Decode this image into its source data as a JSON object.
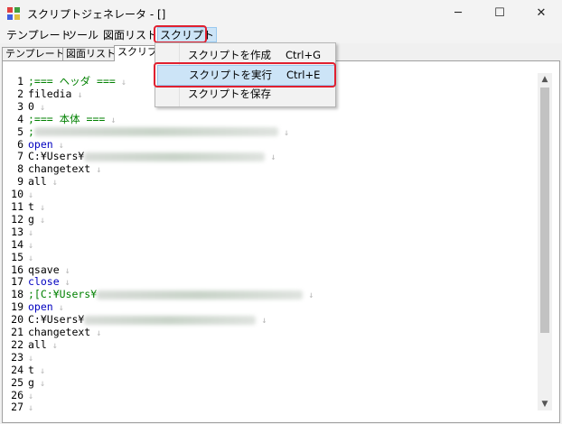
{
  "window": {
    "title": "スクリプトジェネレータ - []",
    "controls": {
      "minimize": "─",
      "maximize": "☐",
      "close": "✕"
    }
  },
  "menubar": {
    "items": [
      "テンプレート",
      "ツール",
      "図面リスト",
      "スクリプト"
    ]
  },
  "tabs": [
    "テンプレート",
    "図面リスト",
    "スクリプト"
  ],
  "dropdown": {
    "items": [
      {
        "label": "スクリプトを作成",
        "shortcut": "Ctrl+G"
      },
      {
        "label": "スクリプトを実行",
        "shortcut": "Ctrl+E"
      },
      {
        "label": "スクリプトを保存",
        "shortcut": ""
      }
    ]
  },
  "editor": {
    "lines": [
      {
        "n": "1",
        "text": ";=== ヘッダ ==="
      },
      {
        "n": "2",
        "text": "filedia"
      },
      {
        "n": "3",
        "text": "0"
      },
      {
        "n": "4",
        "text": ";=== 本体 ==="
      },
      {
        "n": "5",
        "text": ";"
      },
      {
        "n": "6",
        "text": "open"
      },
      {
        "n": "7",
        "text": "C:¥Users¥"
      },
      {
        "n": "8",
        "text": "changetext"
      },
      {
        "n": "9",
        "text": "all"
      },
      {
        "n": "10",
        "text": ""
      },
      {
        "n": "11",
        "text": "t"
      },
      {
        "n": "12",
        "text": "g"
      },
      {
        "n": "13",
        "text": ""
      },
      {
        "n": "14",
        "text": ""
      },
      {
        "n": "15",
        "text": ""
      },
      {
        "n": "16",
        "text": "qsave"
      },
      {
        "n": "17",
        "text": "close"
      },
      {
        "n": "18",
        "text": ";[C:¥Users¥"
      },
      {
        "n": "19",
        "text": "open"
      },
      {
        "n": "20",
        "text": "C:¥Users¥"
      },
      {
        "n": "21",
        "text": "changetext"
      },
      {
        "n": "22",
        "text": "all"
      },
      {
        "n": "23",
        "text": ""
      },
      {
        "n": "24",
        "text": "t"
      },
      {
        "n": "25",
        "text": "g"
      },
      {
        "n": "26",
        "text": ""
      },
      {
        "n": "27",
        "text": ""
      }
    ]
  },
  "colors": {
    "comment": "#008000",
    "keyword": "#0000c0",
    "highlight": "#e02030"
  }
}
